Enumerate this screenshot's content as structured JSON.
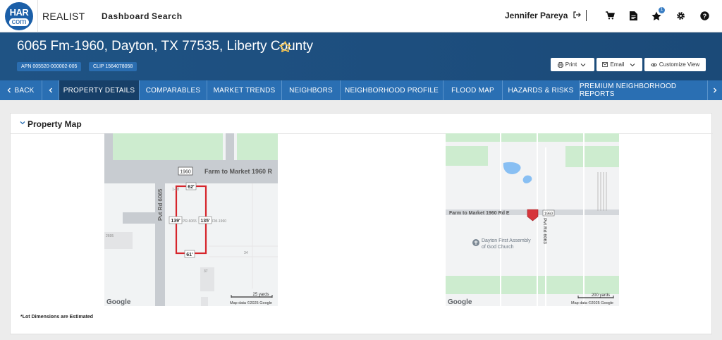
{
  "topbar": {
    "logo_top": "HAR",
    "logo_bottom": "com",
    "brand": "REALIST",
    "nav": [
      "Dashboard",
      "Search"
    ],
    "user_name": "Jennifer Pareya",
    "favorites_count": "1",
    "icons": [
      "cart-icon",
      "document-icon",
      "star-icon",
      "gear-icon",
      "help-icon"
    ]
  },
  "header": {
    "address": "6065 Fm-1960, Dayton, TX 77535, Liberty County",
    "apn": "APN 005520-000002-005",
    "clip": "CLIP 1564078058",
    "print_label": "Print",
    "email_label": "Email",
    "customize_label": "Customize View",
    "accent": "#f2c14e"
  },
  "tabs": {
    "back": "BACK",
    "items": [
      "PROPERTY DETAILS",
      "COMPARABLES",
      "MARKET TRENDS",
      "NEIGHBORS",
      "NEIGHBORHOOD PROFILE",
      "FLOOD MAP",
      "HAZARDS & RISKS",
      "PREMIUM NEIGHBORHOOD REPORTS"
    ],
    "active": "PROPERTY DETAILS"
  },
  "property_map": {
    "title": "Property Map",
    "note": "*Lot Dimensions are Estimated",
    "lot_map": {
      "route_shield": "1960",
      "road_label": "Farm to Market 1960 R",
      "vertical_road": "Pvt Rd 6065",
      "dim_top": "62'",
      "dim_left": "139'",
      "dim_right": "135'",
      "dim_bottom": "61'",
      "parcel_text": "PR-6065",
      "parcel_text_right": "FM-1960",
      "lot_number": "1-68",
      "num_2695": "2695",
      "num_34": "34",
      "num_37": "37",
      "scale": "25 yards",
      "attribution": "Map data ©2025 Google",
      "google": "Google"
    },
    "area_map": {
      "road_label": "Farm to Market 1960 Rd E",
      "route_shield": "1960",
      "vertical_road": "Pvt Rd 6063",
      "poi_line1": "Dayton First Assembly",
      "poi_line2": "of God Church",
      "scale": "200 yards",
      "attribution": "Map data ©2025 Google",
      "google": "Google"
    }
  }
}
